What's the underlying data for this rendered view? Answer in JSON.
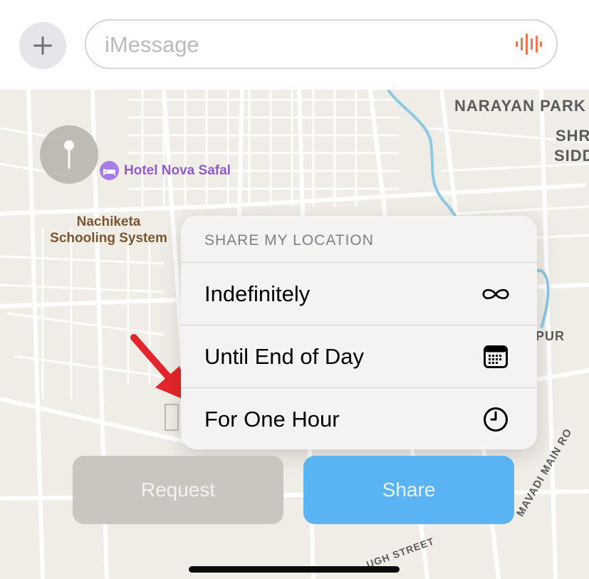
{
  "compose": {
    "placeholder": "iMessage",
    "plus_icon": "plus-icon",
    "audio_icon": "audio-waveform-icon",
    "audio_color": "#f2734f"
  },
  "map": {
    "area_labels": [
      "NARAYAN PARK",
      "SHR",
      "SIDD",
      "PUR",
      "MAVADI MAIN RO",
      "UGH STREET"
    ],
    "poi_hotel": "Hotel Nova Safal",
    "poi_school": "Nachiketa Schooling System"
  },
  "popup": {
    "header": "SHARE MY LOCATION",
    "options": [
      {
        "label": "Indefinitely",
        "icon": "infinity-icon"
      },
      {
        "label": "Until End of Day",
        "icon": "calendar-icon"
      },
      {
        "label": "For One Hour",
        "icon": "clock-icon"
      }
    ]
  },
  "buttons": {
    "request": "Request",
    "share": "Share"
  },
  "annotation": {
    "arrow_color": "#e3262b"
  }
}
